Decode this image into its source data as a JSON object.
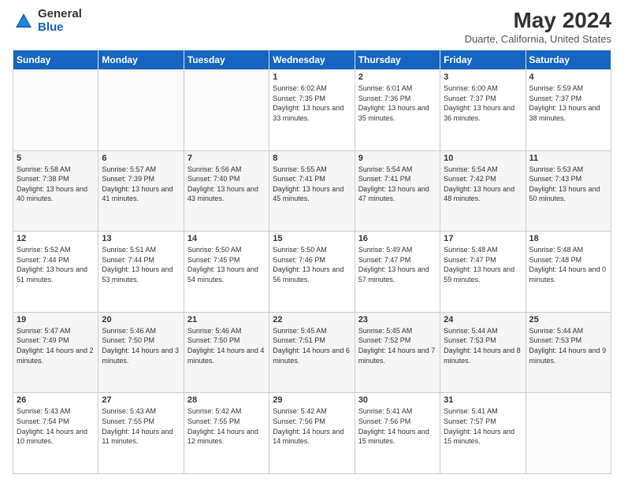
{
  "logo": {
    "general": "General",
    "blue": "Blue"
  },
  "title": "May 2024",
  "subtitle": "Duarte, California, United States",
  "days_header": [
    "Sunday",
    "Monday",
    "Tuesday",
    "Wednesday",
    "Thursday",
    "Friday",
    "Saturday"
  ],
  "weeks": [
    [
      {
        "day": "",
        "sunrise": "",
        "sunset": "",
        "daylight": ""
      },
      {
        "day": "",
        "sunrise": "",
        "sunset": "",
        "daylight": ""
      },
      {
        "day": "",
        "sunrise": "",
        "sunset": "",
        "daylight": ""
      },
      {
        "day": "1",
        "sunrise": "Sunrise: 6:02 AM",
        "sunset": "Sunset: 7:35 PM",
        "daylight": "Daylight: 13 hours and 33 minutes."
      },
      {
        "day": "2",
        "sunrise": "Sunrise: 6:01 AM",
        "sunset": "Sunset: 7:36 PM",
        "daylight": "Daylight: 13 hours and 35 minutes."
      },
      {
        "day": "3",
        "sunrise": "Sunrise: 6:00 AM",
        "sunset": "Sunset: 7:37 PM",
        "daylight": "Daylight: 13 hours and 36 minutes."
      },
      {
        "day": "4",
        "sunrise": "Sunrise: 5:59 AM",
        "sunset": "Sunset: 7:37 PM",
        "daylight": "Daylight: 13 hours and 38 minutes."
      }
    ],
    [
      {
        "day": "5",
        "sunrise": "Sunrise: 5:58 AM",
        "sunset": "Sunset: 7:38 PM",
        "daylight": "Daylight: 13 hours and 40 minutes."
      },
      {
        "day": "6",
        "sunrise": "Sunrise: 5:57 AM",
        "sunset": "Sunset: 7:39 PM",
        "daylight": "Daylight: 13 hours and 41 minutes."
      },
      {
        "day": "7",
        "sunrise": "Sunrise: 5:56 AM",
        "sunset": "Sunset: 7:40 PM",
        "daylight": "Daylight: 13 hours and 43 minutes."
      },
      {
        "day": "8",
        "sunrise": "Sunrise: 5:55 AM",
        "sunset": "Sunset: 7:41 PM",
        "daylight": "Daylight: 13 hours and 45 minutes."
      },
      {
        "day": "9",
        "sunrise": "Sunrise: 5:54 AM",
        "sunset": "Sunset: 7:41 PM",
        "daylight": "Daylight: 13 hours and 47 minutes."
      },
      {
        "day": "10",
        "sunrise": "Sunrise: 5:54 AM",
        "sunset": "Sunset: 7:42 PM",
        "daylight": "Daylight: 13 hours and 48 minutes."
      },
      {
        "day": "11",
        "sunrise": "Sunrise: 5:53 AM",
        "sunset": "Sunset: 7:43 PM",
        "daylight": "Daylight: 13 hours and 50 minutes."
      }
    ],
    [
      {
        "day": "12",
        "sunrise": "Sunrise: 5:52 AM",
        "sunset": "Sunset: 7:44 PM",
        "daylight": "Daylight: 13 hours and 51 minutes."
      },
      {
        "day": "13",
        "sunrise": "Sunrise: 5:51 AM",
        "sunset": "Sunset: 7:44 PM",
        "daylight": "Daylight: 13 hours and 53 minutes."
      },
      {
        "day": "14",
        "sunrise": "Sunrise: 5:50 AM",
        "sunset": "Sunset: 7:45 PM",
        "daylight": "Daylight: 13 hours and 54 minutes."
      },
      {
        "day": "15",
        "sunrise": "Sunrise: 5:50 AM",
        "sunset": "Sunset: 7:46 PM",
        "daylight": "Daylight: 13 hours and 56 minutes."
      },
      {
        "day": "16",
        "sunrise": "Sunrise: 5:49 AM",
        "sunset": "Sunset: 7:47 PM",
        "daylight": "Daylight: 13 hours and 57 minutes."
      },
      {
        "day": "17",
        "sunrise": "Sunrise: 5:48 AM",
        "sunset": "Sunset: 7:47 PM",
        "daylight": "Daylight: 13 hours and 59 minutes."
      },
      {
        "day": "18",
        "sunrise": "Sunrise: 5:48 AM",
        "sunset": "Sunset: 7:48 PM",
        "daylight": "Daylight: 14 hours and 0 minutes."
      }
    ],
    [
      {
        "day": "19",
        "sunrise": "Sunrise: 5:47 AM",
        "sunset": "Sunset: 7:49 PM",
        "daylight": "Daylight: 14 hours and 2 minutes."
      },
      {
        "day": "20",
        "sunrise": "Sunrise: 5:46 AM",
        "sunset": "Sunset: 7:50 PM",
        "daylight": "Daylight: 14 hours and 3 minutes."
      },
      {
        "day": "21",
        "sunrise": "Sunrise: 5:46 AM",
        "sunset": "Sunset: 7:50 PM",
        "daylight": "Daylight: 14 hours and 4 minutes."
      },
      {
        "day": "22",
        "sunrise": "Sunrise: 5:45 AM",
        "sunset": "Sunset: 7:51 PM",
        "daylight": "Daylight: 14 hours and 6 minutes."
      },
      {
        "day": "23",
        "sunrise": "Sunrise: 5:45 AM",
        "sunset": "Sunset: 7:52 PM",
        "daylight": "Daylight: 14 hours and 7 minutes."
      },
      {
        "day": "24",
        "sunrise": "Sunrise: 5:44 AM",
        "sunset": "Sunset: 7:53 PM",
        "daylight": "Daylight: 14 hours and 8 minutes."
      },
      {
        "day": "25",
        "sunrise": "Sunrise: 5:44 AM",
        "sunset": "Sunset: 7:53 PM",
        "daylight": "Daylight: 14 hours and 9 minutes."
      }
    ],
    [
      {
        "day": "26",
        "sunrise": "Sunrise: 5:43 AM",
        "sunset": "Sunset: 7:54 PM",
        "daylight": "Daylight: 14 hours and 10 minutes."
      },
      {
        "day": "27",
        "sunrise": "Sunrise: 5:43 AM",
        "sunset": "Sunset: 7:55 PM",
        "daylight": "Daylight: 14 hours and 11 minutes."
      },
      {
        "day": "28",
        "sunrise": "Sunrise: 5:42 AM",
        "sunset": "Sunset: 7:55 PM",
        "daylight": "Daylight: 14 hours and 12 minutes."
      },
      {
        "day": "29",
        "sunrise": "Sunrise: 5:42 AM",
        "sunset": "Sunset: 7:56 PM",
        "daylight": "Daylight: 14 hours and 14 minutes."
      },
      {
        "day": "30",
        "sunrise": "Sunrise: 5:41 AM",
        "sunset": "Sunset: 7:56 PM",
        "daylight": "Daylight: 14 hours and 15 minutes."
      },
      {
        "day": "31",
        "sunrise": "Sunrise: 5:41 AM",
        "sunset": "Sunset: 7:57 PM",
        "daylight": "Daylight: 14 hours and 15 minutes."
      },
      {
        "day": "",
        "sunrise": "",
        "sunset": "",
        "daylight": ""
      }
    ]
  ]
}
